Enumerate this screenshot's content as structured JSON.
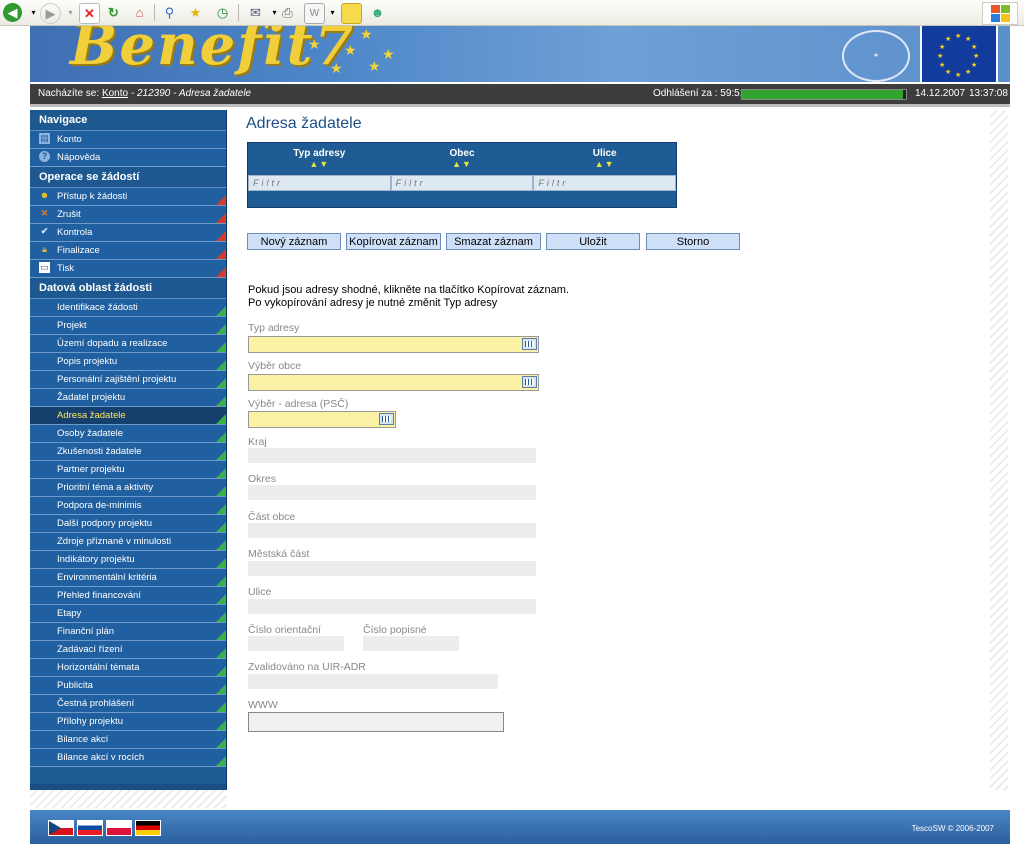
{
  "browser": {
    "toolbar_icons": [
      "back-icon",
      "forward-icon",
      "stop-icon",
      "refresh-icon",
      "home-icon",
      "search-icon",
      "favorites-icon",
      "history-icon",
      "mail-icon",
      "print-icon",
      "edit-icon",
      "notes-icon",
      "messenger-icon"
    ]
  },
  "header": {
    "logo_text": "Benefit7",
    "breadcrumb_prefix": "Nacházíte se:",
    "breadcrumb_link": "Konto",
    "breadcrumb_rest": "- 212390 - Adresa žadatele",
    "logout_label": "Odhlášení za : 59:51",
    "session_progress": 0.98,
    "date": "14.12.2007",
    "time": "13:37:08"
  },
  "sidebar": {
    "nav_title": "Navigace",
    "nav_items": [
      {
        "label": "Konto",
        "icon": "account-icon"
      },
      {
        "label": "Nápověda",
        "icon": "help-icon"
      }
    ],
    "ops_title": "Operace se žádostí",
    "ops_items": [
      {
        "label": "Přístup k žádosti",
        "icon": "users-icon"
      },
      {
        "label": "Zrušit",
        "icon": "cancel-icon"
      },
      {
        "label": "Kontrola",
        "icon": "check-icon"
      },
      {
        "label": "Finalizace",
        "icon": "lock-icon"
      },
      {
        "label": "Tisk",
        "icon": "print-icon"
      }
    ],
    "data_title": "Datová oblast žádosti",
    "data_items": [
      "Identifikace žádosti",
      "Projekt",
      "Území dopadu a realizace",
      "Popis projektu",
      "Personální zajištění projektu",
      "Žadatel projektu",
      "Adresa žadatele",
      "Osoby žadatele",
      "Zkušenosti žadatele",
      "Partner projektu",
      "Prioritní téma a aktivity",
      "Podpora de-minimis",
      "Další podpory projektu",
      "Zdroje příznané v minulosti",
      "Indikátory projektu",
      "Environmentální kritéria",
      "Přehled financování",
      "Etapy",
      "Finanční plán",
      "Zadávací řízení",
      "Horizontální témata",
      "Publicita",
      "Čestná prohlášení",
      "Přílohy projektu",
      "Bilance akcí",
      "Bilance akcí v rocích"
    ],
    "active_item": "Adresa žadatele"
  },
  "main": {
    "title": "Adresa žadatele",
    "grid": {
      "columns": [
        "Typ adresy",
        "Obec",
        "Ulice"
      ],
      "sort_arrows": "▲▼",
      "filter_placeholder": "Filtr"
    },
    "buttons": {
      "new": "Nový záznam",
      "copy": "Kopírovat záznam",
      "delete": "Smazat záznam",
      "save": "Uložit",
      "cancel": "Storno"
    },
    "note_line1": "Pokud jsou adresy shodné, klikněte na tlačítko Kopírovat záznam.",
    "note_line2": "Po vykopírování adresy je nutné změnit Typ adresy",
    "labels": {
      "typ_adresy": "Typ adresy",
      "vyber_obce": "Výběr obce",
      "vyber_adresa": "Výběr - adresa (PSČ)",
      "kraj": "Kraj",
      "okres": "Okres",
      "cast_obce": "Část obce",
      "mestska_cast": "Městská část",
      "ulice": "Ulice",
      "cislo_orientacni": "Číslo orientační",
      "cislo_popisne": "Číslo popisné",
      "zvalidovano": "Zvalidováno na UIR-ADR",
      "www": "WWW"
    },
    "www_value": ""
  },
  "footer": {
    "flags": [
      "cz",
      "sk",
      "pl",
      "de"
    ],
    "copyright": "TescoSW © 2006-2007"
  },
  "colors": {
    "sidebar_blue": "#1f5b94",
    "active_text": "#ffe35a",
    "required_field": "#fbf2a6"
  }
}
